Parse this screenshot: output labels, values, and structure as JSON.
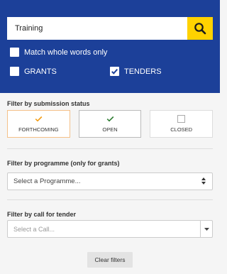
{
  "search": {
    "value": "Training",
    "button_icon": "search-icon"
  },
  "options": {
    "match_whole_words": {
      "label": "Match whole words only",
      "checked": false
    },
    "grants": {
      "label": "GRANTS",
      "checked": false
    },
    "tenders": {
      "label": "TENDERS",
      "checked": true
    }
  },
  "submission_status": {
    "title": "Filter by submission status",
    "buttons": [
      {
        "label": "FORTHCOMING",
        "icon": "check-icon",
        "color": "#f39c12",
        "selected": true
      },
      {
        "label": "OPEN",
        "icon": "check-icon",
        "color": "#2e7d32",
        "selected": true
      },
      {
        "label": "CLOSED",
        "icon": "empty-checkbox-icon",
        "color": "#aaaaaa",
        "selected": false
      }
    ]
  },
  "programme": {
    "title": "Filter by programme (only for grants)",
    "placeholder": "Select a Programme..."
  },
  "call": {
    "title": "Filter by call for tender",
    "placeholder": "Select a Call..."
  },
  "clear_filters_label": "Clear filters",
  "colors": {
    "header_bg": "#1c4099",
    "search_button": "#ffd200"
  }
}
